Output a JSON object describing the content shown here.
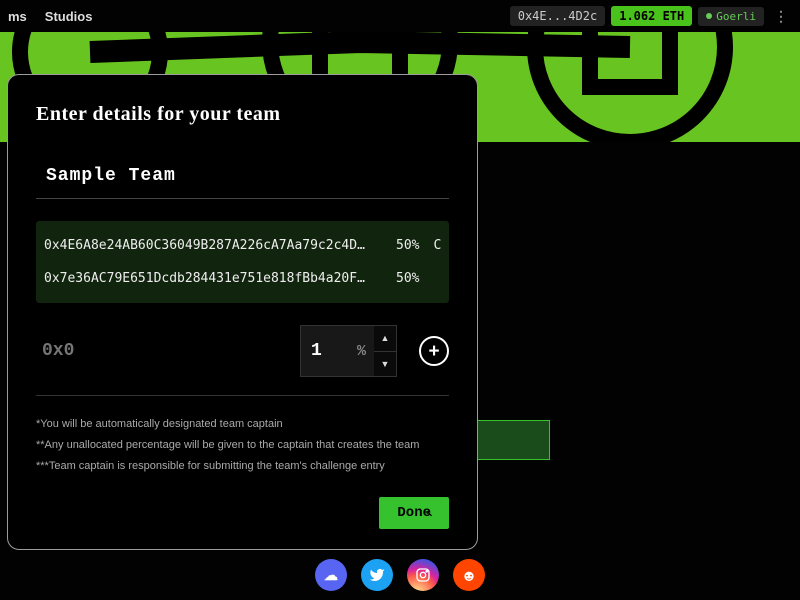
{
  "nav": {
    "items": [
      "ms",
      "Studios"
    ]
  },
  "wallet": {
    "address": "0x4E...4D2c",
    "balance": "1.062 ETH",
    "network": "Goerli"
  },
  "modal": {
    "title": "Enter details for your team",
    "team_name": "Sample Team",
    "members": [
      {
        "address": "0x4E6A8e24AB60C36049B287A226cA7Aa79c2c4D…",
        "percent": "50%",
        "captain": "C"
      },
      {
        "address": "0x7e36AC79E651Dcdb284431e751e818fBb4a20F…",
        "percent": "50%",
        "captain": ""
      }
    ],
    "new_address_placeholder": "0x0",
    "new_percent": "1",
    "percent_symbol": "%",
    "notes": [
      "*You will be automatically designated team captain",
      "**Any unallocated percentage will be given to the captain that creates the team",
      "***Team captain is responsible for submitting the team's challenge entry"
    ],
    "done_label": "Done"
  },
  "social": {
    "discord": "discord-icon",
    "twitter": "twitter-icon",
    "instagram": "instagram-icon",
    "reddit": "reddit-icon"
  }
}
